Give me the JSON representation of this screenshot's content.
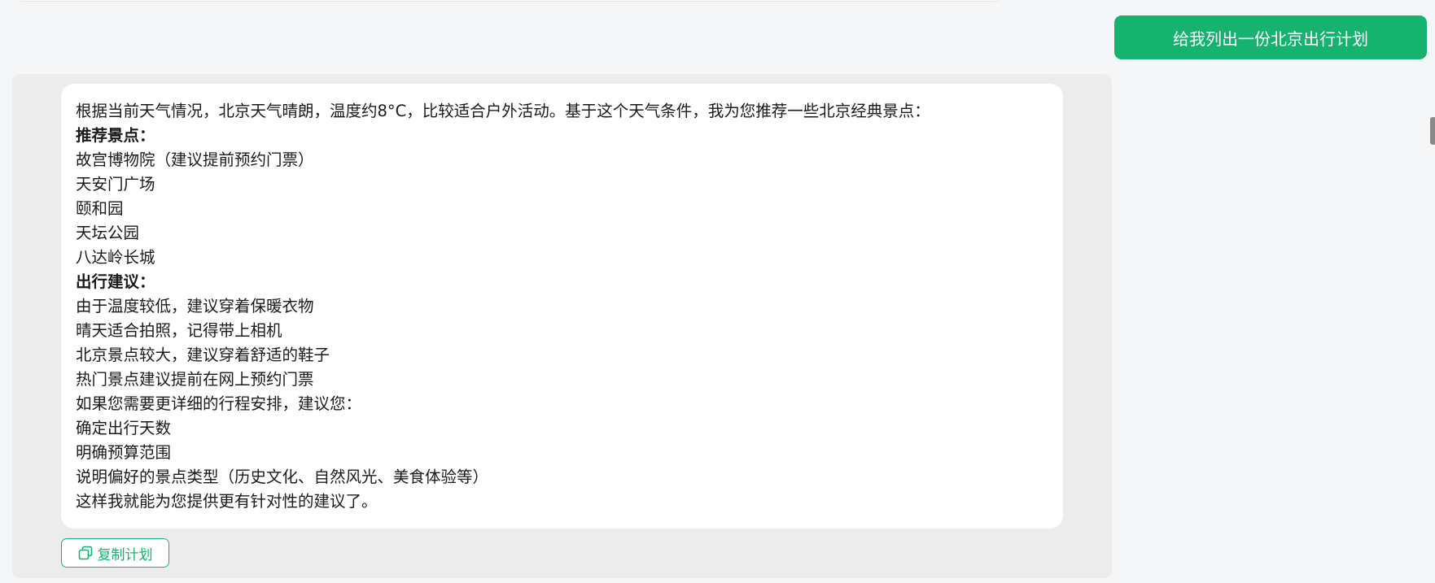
{
  "user_message": {
    "text": "给我列出一份北京出行计划"
  },
  "ai_message": {
    "intro": "根据当前天气情况，北京天气晴朗，温度约8°C，比较适合户外活动。基于这个天气条件，我为您推荐一些北京经典景点：",
    "attractions_heading": "推荐景点：",
    "attractions": [
      "故宫博物院（建议提前预约门票）",
      "天安门广场",
      "颐和园",
      "天坛公园",
      "八达岭长城"
    ],
    "advice_heading": "出行建议：",
    "advice": [
      "由于温度较低，建议穿着保暖衣物",
      "晴天适合拍照，记得带上相机",
      "北京景点较大，建议穿着舒适的鞋子",
      "热门景点建议提前在网上预约门票"
    ],
    "followup_intro": "如果您需要更详细的行程安排，建议您：",
    "followup": [
      "确定出行天数",
      "明确预算范围",
      "说明偏好的景点类型（历史文化、自然风光、美食体验等）"
    ],
    "closing": "这样我就能为您提供更有针对性的建议了。"
  },
  "actions": {
    "copy_label": "复制计划",
    "copy_icon": "copy-icon"
  },
  "colors": {
    "accent": "#16b26f",
    "page_bg": "#f5f6f8",
    "panel_bg": "#ececed",
    "card_bg": "#ffffff"
  }
}
